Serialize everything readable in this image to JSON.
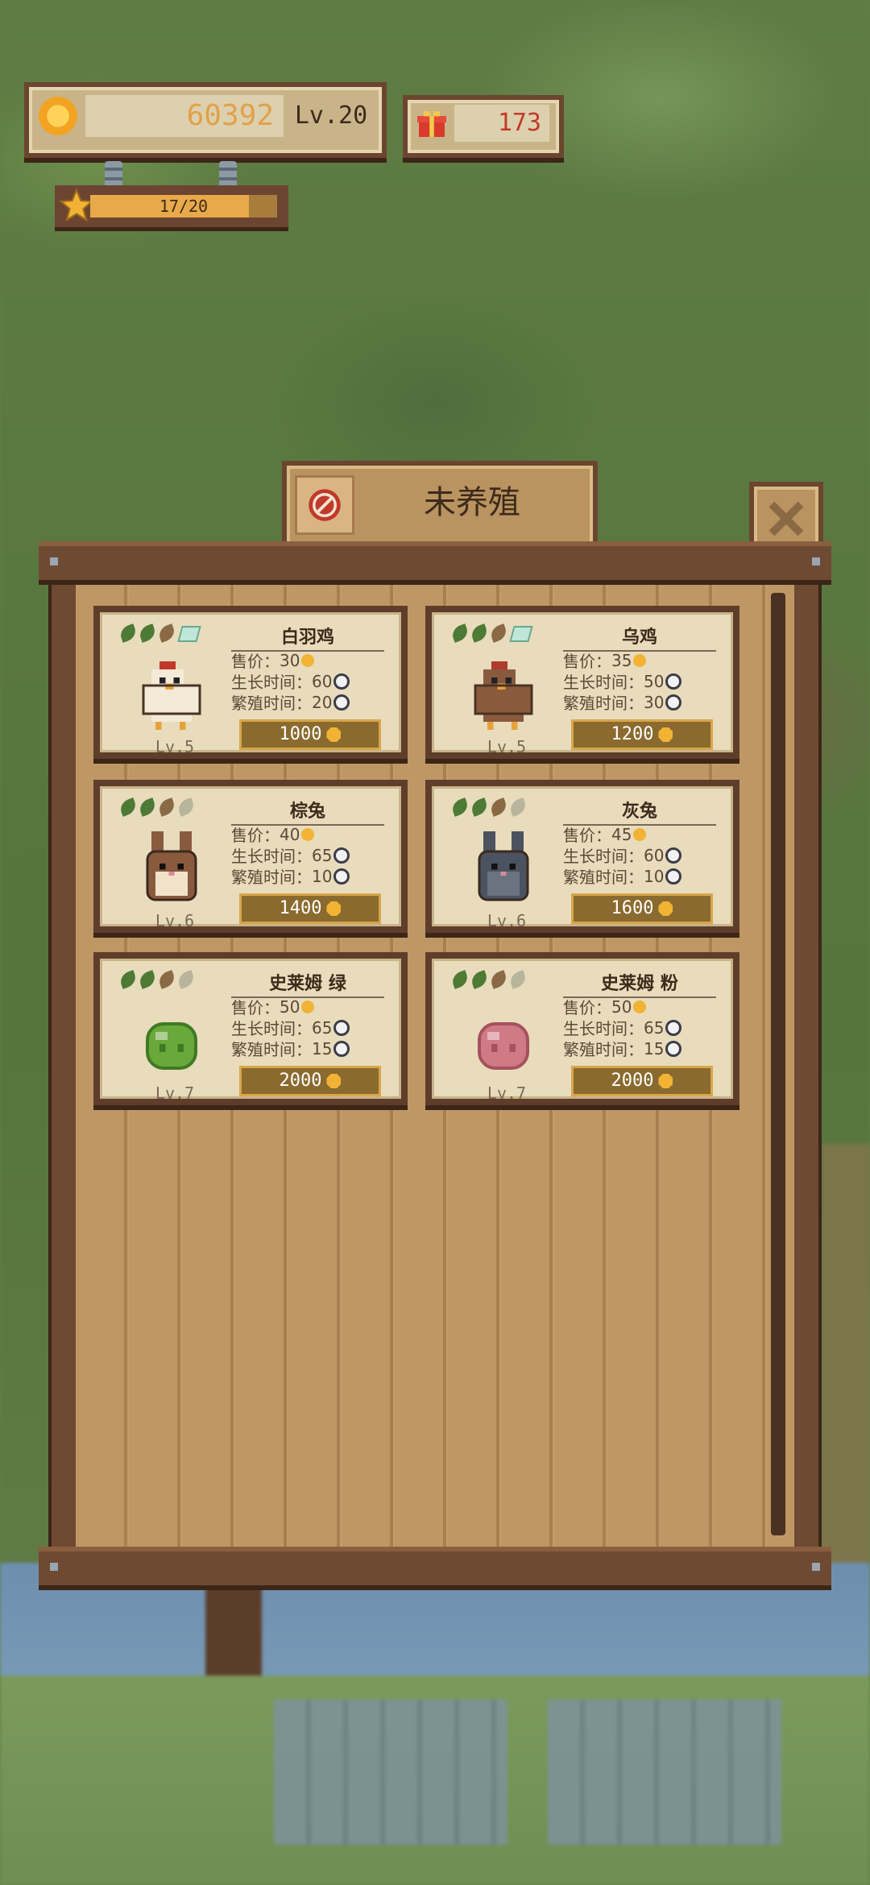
{
  "hud": {
    "coins": "60392",
    "level": "Lv.20",
    "gifts": "173",
    "xp_text": "17/20",
    "xp_fraction": 0.85
  },
  "window": {
    "title": "未养殖"
  },
  "animals": [
    {
      "name": "白羽鸡",
      "price_label": "售价：",
      "price": "30",
      "grow_label": "生长时间：",
      "grow": "60",
      "breed_label": "繁殖时间：",
      "breed": "20",
      "level": "Lv.5",
      "cost": "1000",
      "kind": "chicken",
      "color": "#f3ead8",
      "accent": "#c0392b",
      "tags": [
        "#4d7a35",
        "#4d7a35",
        "#8a6a45",
        "gem"
      ]
    },
    {
      "name": "乌鸡",
      "price_label": "售价：",
      "price": "35",
      "grow_label": "生长时间：",
      "grow": "50",
      "breed_label": "繁殖时间：",
      "breed": "30",
      "level": "Lv.5",
      "cost": "1200",
      "kind": "chicken",
      "color": "#8a5a3e",
      "accent": "#b03a2e",
      "tags": [
        "#4d7a35",
        "#4d7a35",
        "#8a6a45",
        "gem"
      ]
    },
    {
      "name": "棕兔",
      "price_label": "售价：",
      "price": "40",
      "grow_label": "生长时间：",
      "grow": "65",
      "breed_label": "繁殖时间：",
      "breed": "10",
      "level": "Lv.6",
      "cost": "1400",
      "kind": "rabbit",
      "color": "#8a5a3e",
      "accent": "#f2e2cc",
      "tags": [
        "#4d7a35",
        "#4d7a35",
        "#8a6a45",
        "#b9b49c"
      ]
    },
    {
      "name": "灰兔",
      "price_label": "售价：",
      "price": "45",
      "grow_label": "生长时间：",
      "grow": "60",
      "breed_label": "繁殖时间：",
      "breed": "10",
      "level": "Lv.6",
      "cost": "1600",
      "kind": "rabbit",
      "color": "#4c5360",
      "accent": "#6b7380",
      "tags": [
        "#4d7a35",
        "#4d7a35",
        "#8a6a45",
        "#b9b49c"
      ]
    },
    {
      "name": "史莱姆 绿",
      "price_label": "售价：",
      "price": "50",
      "grow_label": "生长时间：",
      "grow": "65",
      "breed_label": "繁殖时间：",
      "breed": "15",
      "level": "Lv.7",
      "cost": "2000",
      "kind": "slime",
      "color": "#6aa83c",
      "accent": "#3f7a22",
      "tags": [
        "#4d7a35",
        "#4d7a35",
        "#8a6a45",
        "#b9b49c"
      ]
    },
    {
      "name": "史莱姆 粉",
      "price_label": "售价：",
      "price": "50",
      "grow_label": "生长时间：",
      "grow": "65",
      "breed_label": "繁殖时间：",
      "breed": "15",
      "level": "Lv.7",
      "cost": "2000",
      "kind": "slime",
      "color": "#d07a86",
      "accent": "#a4525e",
      "tags": [
        "#4d7a35",
        "#4d7a35",
        "#8a6a45",
        "#b9b49c"
      ]
    }
  ]
}
